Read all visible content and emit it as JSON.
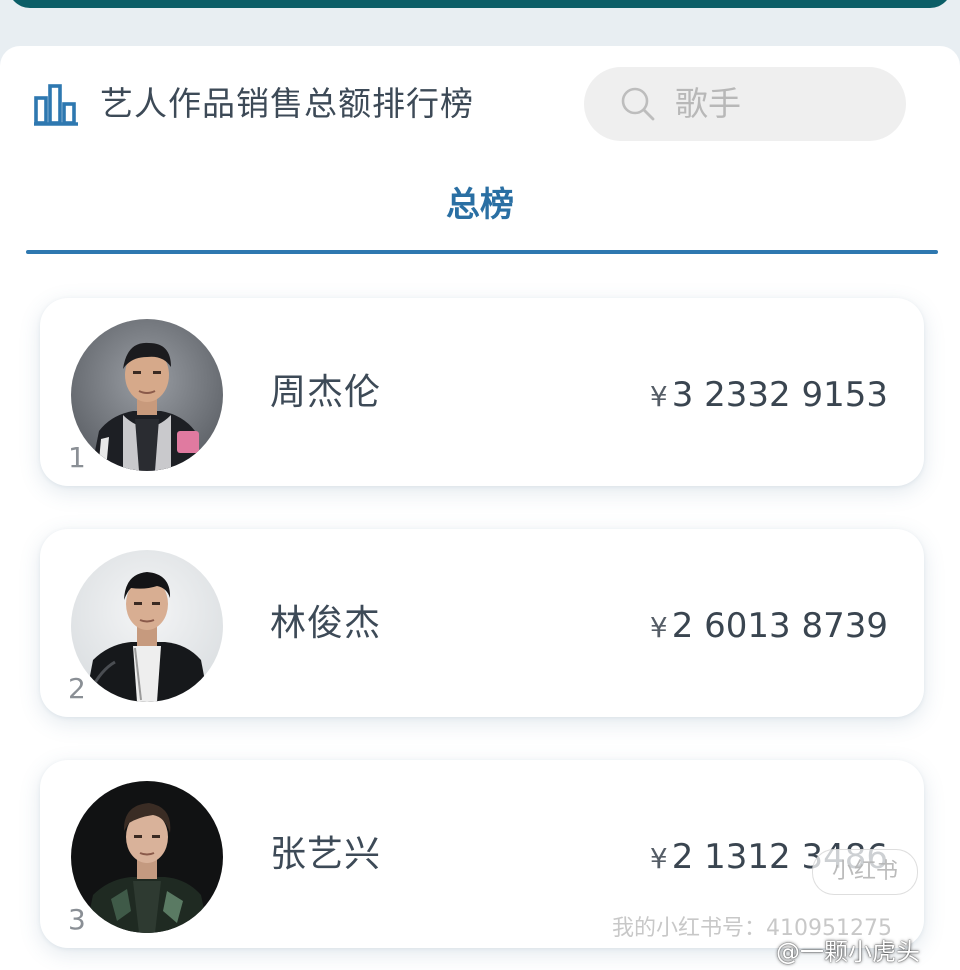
{
  "header": {
    "title": "艺人作品销售总额排行榜",
    "icon": "bar-chart-icon"
  },
  "search": {
    "placeholder": "歌手",
    "icon": "search-icon"
  },
  "tabs": [
    {
      "label": "总榜",
      "active": true
    }
  ],
  "ranking": [
    {
      "rank": "1",
      "name": "周杰伦",
      "currency": "¥",
      "amount": "3 2332 9153"
    },
    {
      "rank": "2",
      "name": "林俊杰",
      "currency": "¥",
      "amount": "2 6013 8739"
    },
    {
      "rank": "3",
      "name": "张艺兴",
      "currency": "¥",
      "amount": "2 1312 3486"
    }
  ],
  "watermark": {
    "text": "我的小红书号：410951275",
    "badge": "小红书",
    "weibo": "@一颗小虎头"
  },
  "colors": {
    "accent": "#2e78b0",
    "top_bar": "#0b5e67",
    "background": "#e8eef2"
  }
}
